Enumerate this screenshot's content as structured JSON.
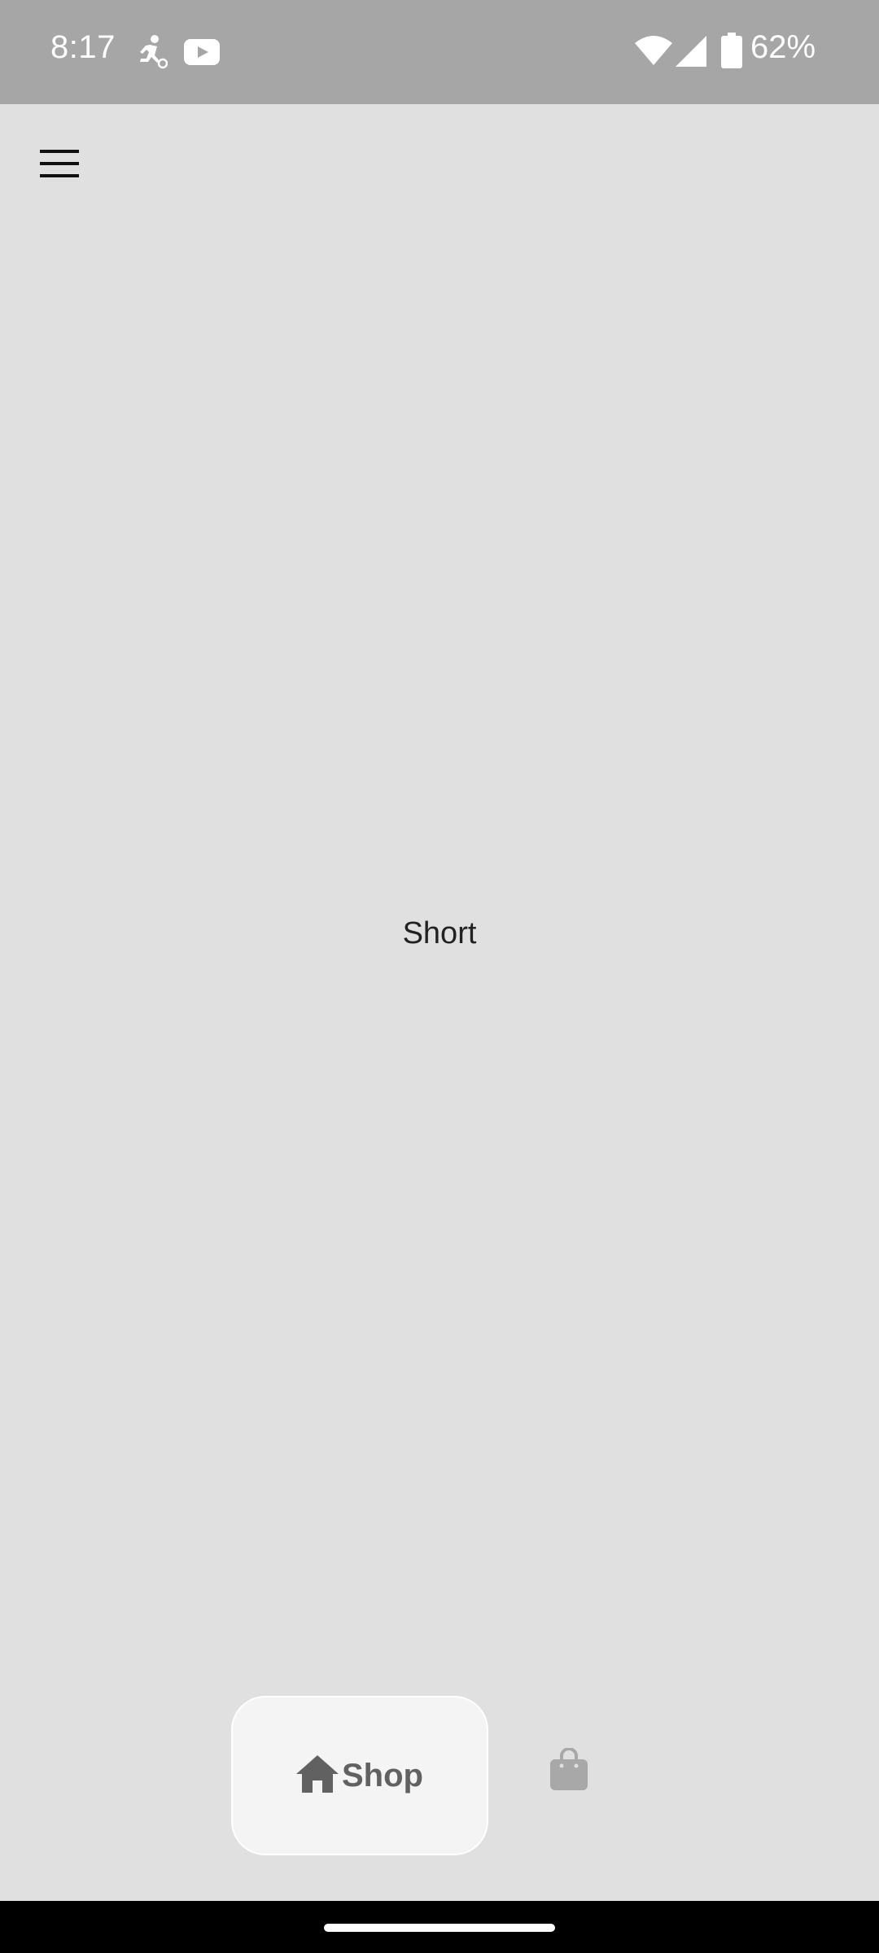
{
  "status_bar": {
    "time": "8:17",
    "battery_percent": "62%",
    "icons": [
      "running-person-icon",
      "youtube-icon",
      "wifi-icon",
      "cellular-signal-icon",
      "battery-icon"
    ]
  },
  "header": {
    "menu_icon": "hamburger-menu-icon"
  },
  "main": {
    "center_text": "Short"
  },
  "bottom_nav": {
    "tabs": [
      {
        "label": "Shop",
        "icon": "home-icon",
        "selected": true
      },
      {
        "label": "",
        "icon": "shopping-bag-icon",
        "selected": false
      }
    ]
  },
  "colors": {
    "status_bar_bg": "#a6a6a6",
    "page_bg": "#e0e0e0",
    "selected_tab_bg": "#f4f4f4",
    "tab_text": "#616161",
    "inactive_icon": "#a8a8a8"
  }
}
